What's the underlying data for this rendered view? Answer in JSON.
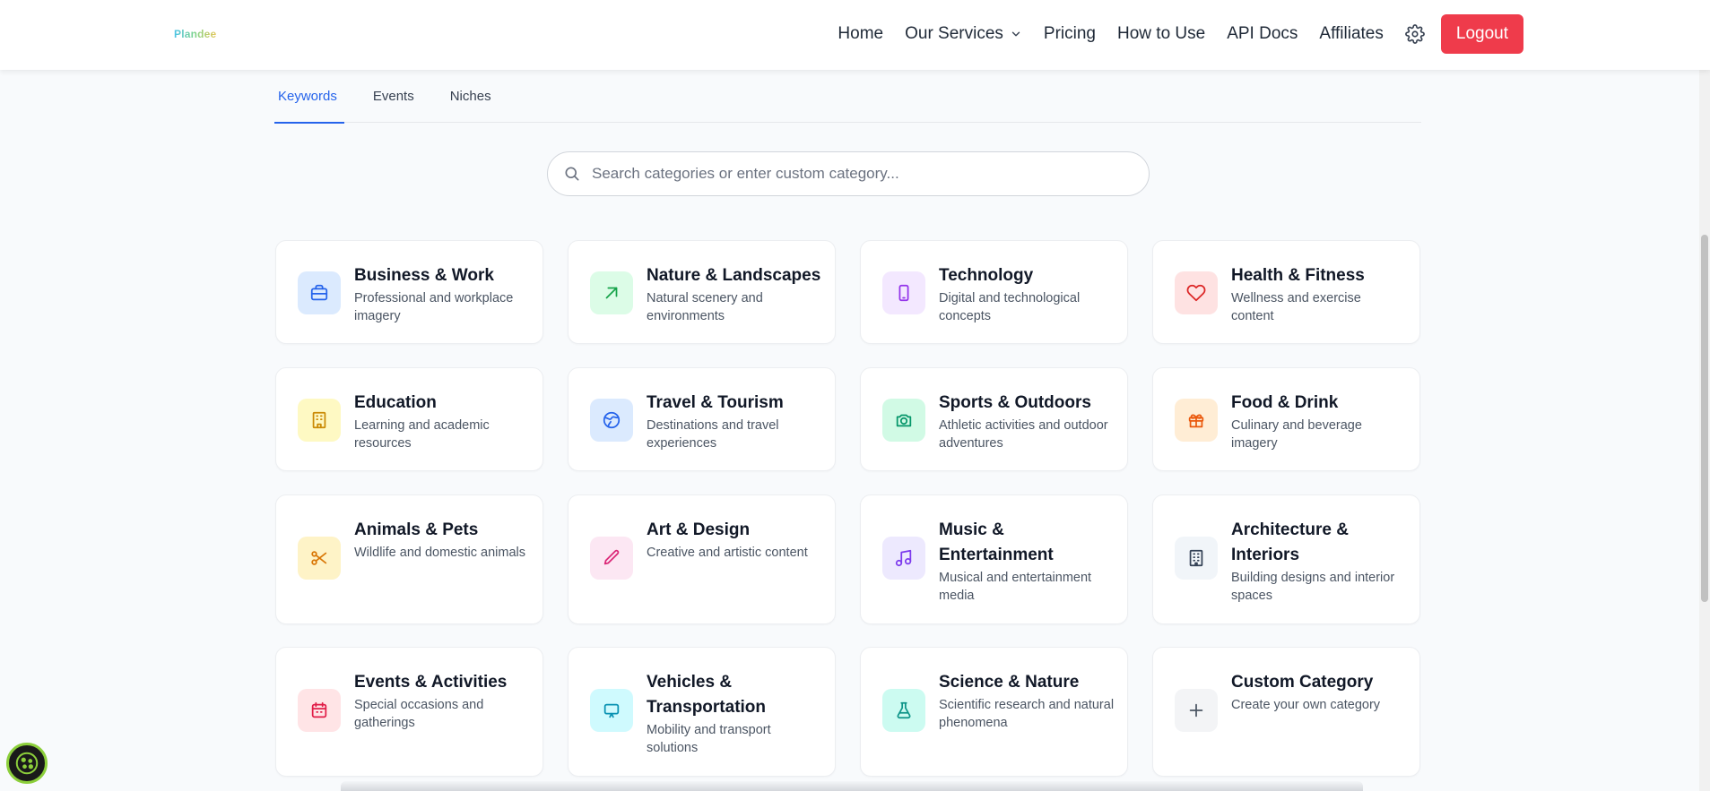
{
  "brand": {
    "logo_text": "Plandee"
  },
  "nav": {
    "items": [
      "Home",
      "Our Services",
      "Pricing",
      "How to Use",
      "API Docs",
      "Affiliates"
    ],
    "logout_label": "Logout",
    "logout_color": "#ef3b4b"
  },
  "tabs": [
    {
      "label": "Keywords",
      "active": true
    },
    {
      "label": "Events",
      "active": false
    },
    {
      "label": "Niches",
      "active": false
    }
  ],
  "search": {
    "placeholder": "Search categories or enter custom category...",
    "value": ""
  },
  "categories": [
    {
      "title": "Business & Work",
      "description": "Professional and workplace imagery",
      "icon": "briefcase-icon",
      "tint": "#dbeafe",
      "color": "#2563eb"
    },
    {
      "title": "Nature & Landscapes",
      "description": "Natural scenery and environments",
      "icon": "arrow-up-right-icon",
      "tint": "#dcfce7",
      "color": "#16a34a"
    },
    {
      "title": "Technology",
      "description": "Digital and technological concepts",
      "icon": "smartphone-icon",
      "tint": "#f3e8ff",
      "color": "#9333ea"
    },
    {
      "title": "Health & Fitness",
      "description": "Wellness and exercise content",
      "icon": "heart-icon",
      "tint": "#fee2e2",
      "color": "#dc2626"
    },
    {
      "title": "Education",
      "description": "Learning and academic resources",
      "icon": "building-icon",
      "tint": "#fef9c3",
      "color": "#ca8a04"
    },
    {
      "title": "Travel & Tourism",
      "description": "Destinations and travel experiences",
      "icon": "globe-icon",
      "tint": "#dbeafe",
      "color": "#2563eb"
    },
    {
      "title": "Sports & Outdoors",
      "description": "Athletic activities and outdoor adventures",
      "icon": "camera-icon",
      "tint": "#d1fae5",
      "color": "#059669"
    },
    {
      "title": "Food & Drink",
      "description": "Culinary and beverage imagery",
      "icon": "gift-icon",
      "tint": "#ffedd5",
      "color": "#ea580c"
    },
    {
      "title": "Animals & Pets",
      "description": "Wildlife and domestic animals",
      "icon": "scissors-icon",
      "tint": "#fef3c7",
      "color": "#d97706"
    },
    {
      "title": "Art & Design",
      "description": "Creative and artistic content",
      "icon": "pencil-icon",
      "tint": "#fce7f3",
      "color": "#db2777"
    },
    {
      "title": "Music & Entertainment",
      "description": "Musical and entertainment media",
      "icon": "music-icon",
      "tint": "#ede9fe",
      "color": "#7c3aed"
    },
    {
      "title": "Architecture & Interiors",
      "description": "Building designs and interior spaces",
      "icon": "office-building-icon",
      "tint": "#f1f5f9",
      "color": "#334155"
    },
    {
      "title": "Events & Activities",
      "description": "Special occasions and gatherings",
      "icon": "calendar-icon",
      "tint": "#ffe4e6",
      "color": "#e11d48"
    },
    {
      "title": "Vehicles & Transportation",
      "description": "Mobility and transport solutions",
      "icon": "monitor-icon",
      "tint": "#cffafe",
      "color": "#0891b2"
    },
    {
      "title": "Science & Nature",
      "description": "Scientific research and natural phenomena",
      "icon": "flask-icon",
      "tint": "#ccfbf1",
      "color": "#0d9488"
    },
    {
      "title": "Custom Category",
      "description": "Create your own category",
      "icon": "plus-icon",
      "tint": "#f3f4f6",
      "color": "#4b5563"
    }
  ]
}
